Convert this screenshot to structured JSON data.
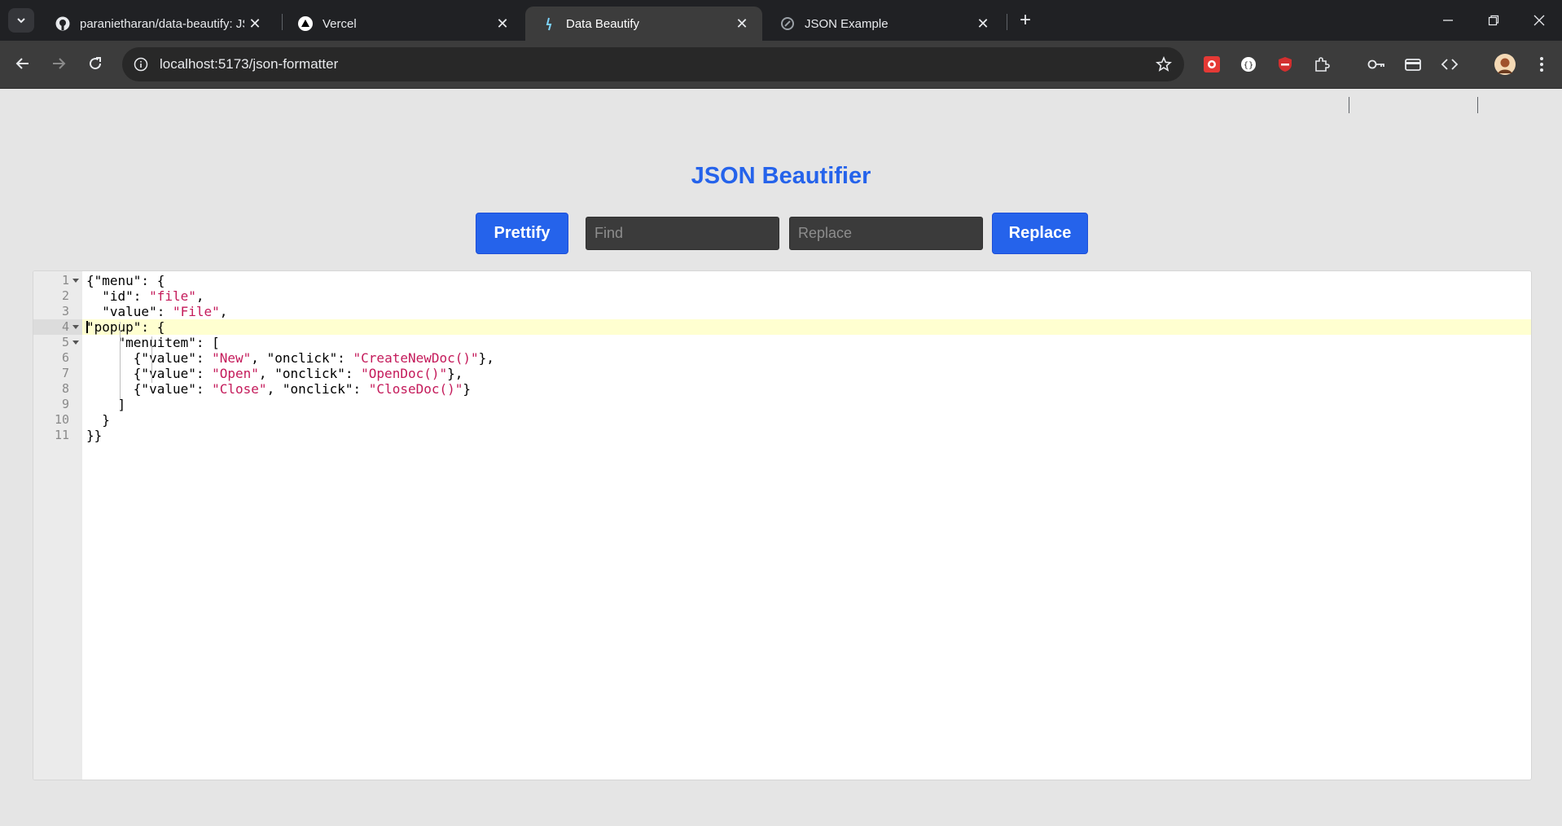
{
  "browser": {
    "tabs": [
      {
        "title": "paranietharan/data-beautify: JS",
        "favicon": "github-icon",
        "active": false
      },
      {
        "title": "Vercel",
        "favicon": "vercel-icon",
        "active": false
      },
      {
        "title": "Data Beautify",
        "favicon": "vite-icon",
        "active": true
      },
      {
        "title": "JSON Example",
        "favicon": "json-icon",
        "active": false
      }
    ],
    "url": "localhost:5173/json-formatter",
    "extensions": [
      "ext-red-icon",
      "ext-white-circle-icon",
      "ext-shield-icon",
      "puzzle-icon",
      "key-icon",
      "card-icon",
      "code-icon",
      "avatar"
    ]
  },
  "page": {
    "title": "JSON Beautifier",
    "prettify_label": "Prettify",
    "find_placeholder": "Find",
    "replace_placeholder": "Replace",
    "replace_label": "Replace"
  },
  "editor": {
    "active_line": 4,
    "lines": [
      {
        "num": "1",
        "fold": true,
        "segments": [
          {
            "t": "{\"menu\": {",
            "s": false
          }
        ]
      },
      {
        "num": "2",
        "fold": false,
        "segments": [
          {
            "t": "  \"id\": ",
            "s": false
          },
          {
            "t": "\"file\"",
            "s": true
          },
          {
            "t": ",",
            "s": false
          }
        ]
      },
      {
        "num": "3",
        "fold": false,
        "segments": [
          {
            "t": "  \"value\": ",
            "s": false
          },
          {
            "t": "\"File\"",
            "s": true
          },
          {
            "t": ",",
            "s": false
          }
        ]
      },
      {
        "num": "4",
        "fold": true,
        "segments": [
          {
            "t": "\"popup\": {",
            "s": false
          }
        ]
      },
      {
        "num": "5",
        "fold": true,
        "segments": [
          {
            "t": "    \"menuitem\": [",
            "s": false
          }
        ]
      },
      {
        "num": "6",
        "fold": false,
        "segments": [
          {
            "t": "      {\"value\": ",
            "s": false
          },
          {
            "t": "\"New\"",
            "s": true
          },
          {
            "t": ", \"onclick\": ",
            "s": false
          },
          {
            "t": "\"CreateNewDoc()\"",
            "s": true
          },
          {
            "t": "},",
            "s": false
          }
        ]
      },
      {
        "num": "7",
        "fold": false,
        "segments": [
          {
            "t": "      {\"value\": ",
            "s": false
          },
          {
            "t": "\"Open\"",
            "s": true
          },
          {
            "t": ", \"onclick\": ",
            "s": false
          },
          {
            "t": "\"OpenDoc()\"",
            "s": true
          },
          {
            "t": "},",
            "s": false
          }
        ]
      },
      {
        "num": "8",
        "fold": false,
        "segments": [
          {
            "t": "      {\"value\": ",
            "s": false
          },
          {
            "t": "\"Close\"",
            "s": true
          },
          {
            "t": ", \"onclick\": ",
            "s": false
          },
          {
            "t": "\"CloseDoc()\"",
            "s": true
          },
          {
            "t": "}",
            "s": false
          }
        ]
      },
      {
        "num": "9",
        "fold": false,
        "segments": [
          {
            "t": "    ]",
            "s": false
          }
        ]
      },
      {
        "num": "10",
        "fold": false,
        "segments": [
          {
            "t": "  }",
            "s": false
          }
        ]
      },
      {
        "num": "11",
        "fold": false,
        "segments": [
          {
            "t": "}}",
            "s": false
          }
        ]
      }
    ]
  },
  "colors": {
    "accent": "#2563eb",
    "string": "#c41a5a",
    "active_line": "#ffffd0",
    "page_bg": "#e5e5e5"
  }
}
